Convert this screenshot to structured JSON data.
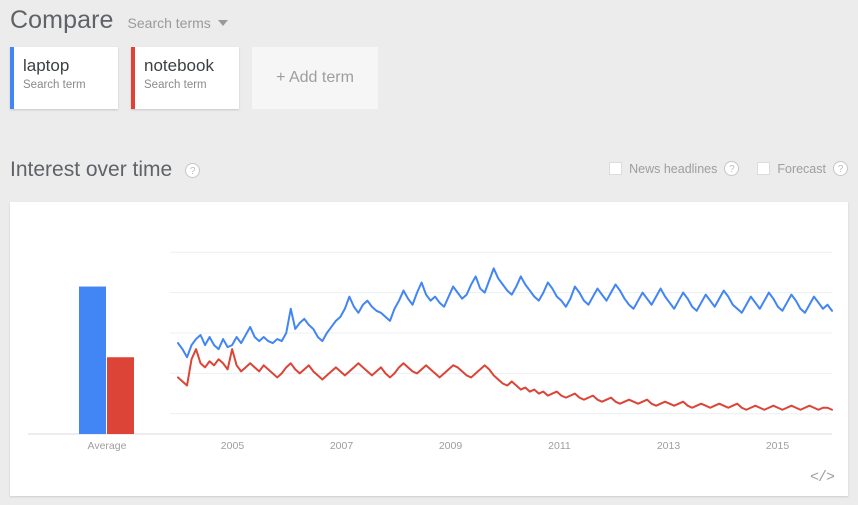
{
  "header": {
    "compare_title": "Compare",
    "dropdown_label": "Search terms",
    "dropdown_icon": "chevron-down-icon"
  },
  "terms": [
    {
      "name": "laptop",
      "subtitle": "Search term",
      "color": "#4285F4"
    },
    {
      "name": "notebook",
      "subtitle": "Search term",
      "color": "#DB4437"
    }
  ],
  "add_term": {
    "label": "+ Add term"
  },
  "section": {
    "title": "Interest over time",
    "help_label": "?",
    "help_icon": "question-mark-icon"
  },
  "toggles": [
    {
      "label": "News headlines",
      "checked": false,
      "help_label": "?"
    },
    {
      "label": "Forecast",
      "checked": false,
      "help_label": "?"
    }
  ],
  "chart_footer": {
    "embed_label": "</>",
    "embed_icon": "embed-code-icon"
  },
  "chart_data": {
    "type": "line",
    "title": "Interest over time",
    "xlabel": "",
    "ylabel": "",
    "ylim": [
      0,
      100
    ],
    "grid": true,
    "legend_position": "none",
    "xtick_labels": [
      "2005",
      "2007",
      "2009",
      "2011",
      "2013",
      "2015"
    ],
    "xtick_positions": [
      0.0833,
      0.25,
      0.4167,
      0.5833,
      0.75,
      0.9167
    ],
    "gridline_values": [
      90,
      70,
      50,
      30,
      10
    ],
    "average_bar_chart": {
      "type": "bar",
      "category": "Average",
      "categories": [
        "Average"
      ],
      "series": [
        {
          "name": "laptop",
          "values": [
            73
          ],
          "color": "#4285F4"
        },
        {
          "name": "notebook",
          "values": [
            38
          ],
          "color": "#DB4437"
        }
      ]
    },
    "series": [
      {
        "name": "laptop",
        "color": "#4285F4",
        "values": [
          45,
          42,
          38,
          44,
          47,
          49,
          44,
          48,
          44,
          42,
          47,
          43,
          44,
          48,
          45,
          49,
          53,
          48,
          46,
          48,
          46,
          45,
          47,
          46,
          50,
          62,
          52,
          55,
          57,
          54,
          52,
          48,
          46,
          50,
          53,
          56,
          58,
          62,
          68,
          63,
          60,
          64,
          66,
          63,
          61,
          60,
          58,
          56,
          62,
          66,
          71,
          67,
          64,
          70,
          75,
          69,
          66,
          68,
          65,
          63,
          68,
          73,
          70,
          67,
          69,
          74,
          78,
          72,
          70,
          76,
          82,
          77,
          74,
          71,
          69,
          73,
          78,
          74,
          71,
          68,
          66,
          70,
          75,
          72,
          68,
          66,
          63,
          67,
          73,
          70,
          66,
          64,
          68,
          72,
          69,
          66,
          70,
          74,
          71,
          67,
          64,
          62,
          66,
          70,
          67,
          64,
          68,
          72,
          68,
          65,
          62,
          66,
          70,
          67,
          63,
          61,
          65,
          69,
          66,
          63,
          67,
          71,
          68,
          64,
          62,
          60,
          64,
          68,
          65,
          62,
          66,
          70,
          67,
          63,
          61,
          65,
          69,
          66,
          62,
          60,
          64,
          68,
          65,
          62,
          64,
          61
        ]
      },
      {
        "name": "notebook",
        "color": "#DB4437",
        "values": [
          28,
          26,
          24,
          37,
          42,
          35,
          33,
          36,
          34,
          37,
          35,
          32,
          42,
          34,
          31,
          33,
          35,
          33,
          31,
          34,
          32,
          30,
          28,
          30,
          33,
          35,
          32,
          30,
          32,
          34,
          31,
          29,
          27,
          29,
          31,
          33,
          31,
          29,
          31,
          33,
          35,
          33,
          31,
          29,
          31,
          33,
          30,
          28,
          30,
          33,
          35,
          33,
          31,
          30,
          32,
          34,
          32,
          30,
          28,
          30,
          32,
          34,
          33,
          31,
          29,
          28,
          30,
          32,
          34,
          32,
          29,
          27,
          25,
          24,
          26,
          24,
          22,
          23,
          21,
          22,
          20,
          21,
          19,
          20,
          21,
          19,
          18,
          19,
          20,
          18,
          17,
          18,
          19,
          17,
          16,
          17,
          18,
          16,
          15,
          16,
          17,
          16,
          15,
          16,
          17,
          15,
          14,
          15,
          16,
          15,
          14,
          15,
          16,
          14,
          13,
          14,
          15,
          14,
          13,
          14,
          15,
          14,
          13,
          14,
          15,
          13,
          12,
          13,
          14,
          13,
          12,
          13,
          14,
          13,
          12,
          13,
          14,
          13,
          12,
          13,
          14,
          13,
          12,
          13,
          13,
          12
        ]
      }
    ]
  }
}
